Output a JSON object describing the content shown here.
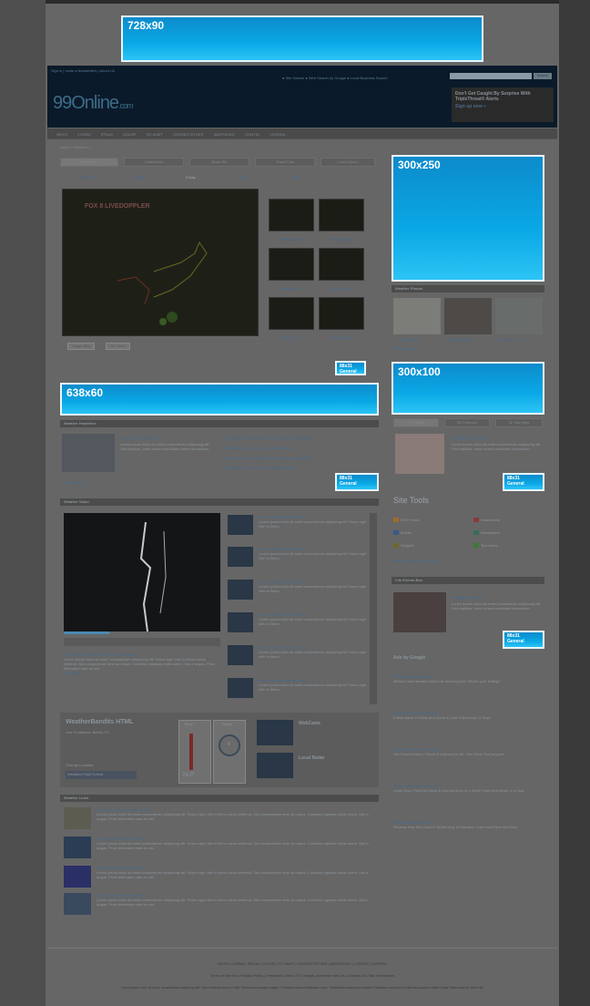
{
  "ads": {
    "leaderboard": "728x90",
    "rectangle": "300x250",
    "skyscraper_small": "300x100",
    "banner": "638x60",
    "button": "88x31",
    "button_sub": "General"
  },
  "header": {
    "topnav": "Sign in  |  Invite a Newsletters  |  About Us",
    "toplinks": "● Site Search   ● Web Search by Google   ● Local Business Search",
    "search_button": "Search",
    "logo_main": "99Online",
    "logo_sub": ".com",
    "promo_text": "Don't Get Caught By Surprise With TripleThreat® Alerts",
    "promo_link": "Sign up now »"
  },
  "nav": [
    "NEWS",
    "LOREM",
    "IPSUM",
    "DOLOR",
    "SIT AMET",
    "CONSECTETUER",
    "ADIPISCING",
    "CONTIN",
    "VIVERRA"
  ],
  "breadcrumb": "Home > Weather >",
  "tabs": [
    "Forecasts",
    "Local Areas",
    "Quick Wx",
    "Travel Cast",
    "Lorem Ipsum"
  ],
  "subtabs": [
    "Current",
    "Hourly",
    "3 Day",
    "7 Day",
    "Travel"
  ],
  "map_brand": "FOX 8 LIVEDOPPLER",
  "thumb_caption": [
    "Image Title",
    "Image Title",
    "Image Title",
    "Image Title",
    "Image Title",
    "Image Title"
  ],
  "map_buttons": [
    "Larger Map",
    "On Zoom"
  ],
  "sections": {
    "headlines": "Weather Headlines",
    "video": "Weather Video",
    "links": "Weather Links",
    "photos": "Weather Photos",
    "sitetools": "Site Tools",
    "lifefocus": "Life Events Box",
    "ads_google": "Ads by Google"
  },
  "headline": {
    "title": "Lorem Ipsum Dolor Sit",
    "body": "Lorem ipsum dolor sit amet consectetuer adipiscing elit. Sed dapibus, tortor viverra condimen lorem fermentum.",
    "more": "More Stories »"
  },
  "headline_bullets": [
    "Lorem ipsum dolor sit amet consectetuer adipiscing",
    "Sed dapibus, tortor viverra condimentum",
    "Lorem ipsum dolor sit amet consectetuer adipiscing",
    "Sed dapibus, tortor viverra condimentum"
  ],
  "video_items": [
    "Lorem ipsum dolor sit amet.",
    "Lorem ipsum dolor sit amet.",
    "Lorem ipsum dolor sit amet.",
    "Lorem ipsum dolor sit amet.",
    "Lorem ipsum dolor sit amet.",
    "Lorem ipsum dolor sit amet."
  ],
  "video_item_body": "Lorem ipsum dolor sit amet consectetuer adipiscing elit Fusce eget nibh in libero.",
  "video_caption": {
    "title": "Lorem ipsum dolor sit amet, consectetuer.",
    "body": "Lorem ipsum dolor sit amet, consectetuer adipiscing elit. Fusce eget nibh in libero varius eleifend. Sed consectetuer sem ac neque. Curabitur egestas mollis lorem. Sed a augue. Proin bibendum nam ac nisi.",
    "more": "Full Story »"
  },
  "widget": {
    "title": "WeatherBandits HTML",
    "subtitle": "Live Conditions: WAAA-TV",
    "temp_label": "Temp",
    "wind_label": "Winds",
    "temp_value": "74.0°",
    "wind_value": "4",
    "webcams": "WebCams",
    "local_radar": "Local Radar",
    "location_label": "Change Location:",
    "location_value": "Westland High School"
  },
  "links": [
    {
      "title": "Hurricane Preparedness Guide",
      "body": "Lorem ipsum dolor sit amet consectetuer adipiscing elit. Fusce eget nibh in libero varius eleifend. Sed consectetuer sem ac neque. Curabitur egestas mollis lorem. Sed a augue. Proin bibendum nam ac nisi."
    },
    {
      "title": "Lorem ipsum dolor sit amet",
      "body": "Lorem ipsum dolor sit amet consectetuer adipiscing elit. Fusce eget nibh in libero varius eleifend. Sed consectetuer sem ac neque. Curabitur egestas mollis lorem. Sed a augue. Proin bibendum nam ac nisi."
    },
    {
      "title": "Lorem ipsum dolor sit amet",
      "body": "Lorem ipsum dolor sit amet consectetuer adipiscing elit. Fusce eget nibh in libero varius eleifend. Sed consectetuer sem ac neque. Curabitur egestas mollis lorem. Sed a augue. Proin bibendum nam ac nisi."
    },
    {
      "title": "Lorem ipsum dolor sit amet",
      "body": "Lorem ipsum dolor sit amet consectetuer adipiscing elit. Fusce eget nibh in libero varius eleifend. Sed consectetuer sem ac neque. Curabitur egestas mollis lorem. Sed a augue. Proin bibendum nam ac nisi."
    }
  ],
  "photo_captions": [
    "Lil Blizzard",
    "Weather Clouds",
    "Hurricane Rita"
  ],
  "photos_more": "More Photos »",
  "side_tabs": [
    "T.C. Details",
    "W. Forecast",
    "W. Warnings"
  ],
  "side_feature": {
    "title": "Weather Gallery News",
    "body": "Lorem ipsum dolor sit amet consectetuer adipiscing elit. Sed dapibus, tortor viverra condimen fermentum."
  },
  "site_tools": [
    "RSS Feeds",
    "Email Alerts",
    "Mobile",
    "Newsletters",
    "Widgets",
    "Text Alerts"
  ],
  "site_tools_link": "Make 99 Your Home Page »",
  "life_feature": {
    "title": "MichiganFishing.tv",
    "body": "Lorem ipsum dolor sit amet consectetuer adipiscing elit. Sed dapibus, tortor viverra condimen fermentum."
  },
  "google_ads": [
    {
      "title": "Prepare to be Shocked",
      "body": "Millions have already taken this amazing test. What's your Rating?"
    },
    {
      "title": "10 Rules for Stomach Fat",
      "body": "Follow these 10 Easy and Quick & Lose 9 lbs every 11 Days"
    },
    {
      "title": "Find a Person in 1 Minute",
      "body": "Get Current Name, Phone & Address for All - See Free. Find anyone!"
    },
    {
      "title": "Single Mom Makes $7k/g",
      "body": "Learn How I Fired My Boss & Earning More in a Week Than Most Make in a Year."
    },
    {
      "title": "Million Dollar Mistake",
      "body": "Reveals How She Does It. Works only 20 Minutes. Learn how Here and Now."
    }
  ],
  "footer_nav": "NEWS  |  LOREM  |  IPSUM  |  DOLOR  |  SIT AMET  |  CONSECTETUER  |  ADIPISCING  |  CONTIN  |  VIVERRA",
  "footer_links": "Terms of Service  |  Privacy Policy  |  Feedback  |  Jobs  |  TV Listings  |  Advertise with Us  |  Contact Us  |  Site Information",
  "footer_copy": "Lorem ipsum dolor sit amet, consectetuer adipiscing elit. Nam vehicula lorem at nibh. Sed ornare congue sapien. Praesent rutrum vestibulum nunc. Vestibulum ante ipsum primis in faucibus orci luctus et ultrices posuere cubilia Curae; Maecenas sit amet nisl."
}
